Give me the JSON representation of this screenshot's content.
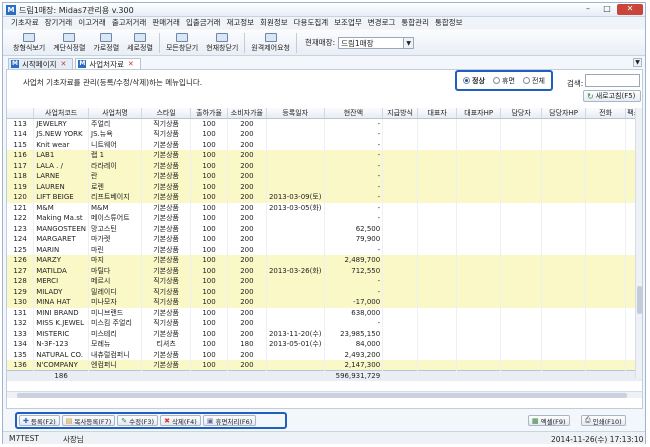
{
  "window": {
    "title": "드림1매장: Midas7관리용 v.300",
    "controls": [
      "–",
      "□",
      "✕"
    ]
  },
  "menu": [
    "기초자료",
    "장기거래",
    "이고거래",
    "출고저거래",
    "판매거래",
    "입출금거래",
    "재고정보",
    "회원정보",
    "다용도집계",
    "보조업무",
    "변경로그",
    "통합관리",
    "통합정보"
  ],
  "toolbar": {
    "buttons": [
      "창형식보기",
      "계단식정렬",
      "가로정렬",
      "세로정렬",
      "모든창닫기",
      "현재창닫기",
      "원격제어요청"
    ],
    "shop_label": "현재매장:",
    "shop_value": "드림1매장"
  },
  "tabs": [
    {
      "label": "시작페이지",
      "closable": true
    },
    {
      "label": "사업처자료",
      "closable": true
    }
  ],
  "page": {
    "description": "사업처 기초자료를 관리(등록/수정/삭제)하는 메뉴입니다.",
    "status_filter": {
      "options": [
        "정상",
        "휴면",
        "전체"
      ],
      "selected": "정상"
    },
    "search_label": "검색:",
    "search_value": "",
    "refresh_label": "새로고침(F5)"
  },
  "table": {
    "columns": [
      "",
      "사업처코드",
      "사업처명",
      "스타일",
      "출하가율",
      "소비자가율",
      "등록일자",
      "현잔액",
      "지급방식",
      "대표자",
      "대표자HP",
      "담당자",
      "담당자HP",
      "전화",
      "팩스"
    ],
    "rows": [
      {
        "no": "113",
        "code": "JEWELRY",
        "name": "주얼리",
        "style": "직기상품",
        "ship": "100",
        "cons": "200",
        "date": "",
        "balance": "-",
        "hl": false
      },
      {
        "no": "114",
        "code": "JS.NEW YORK",
        "name": "JS.뉴욕",
        "style": "직기상품",
        "ship": "100",
        "cons": "200",
        "date": "",
        "balance": "-",
        "hl": false
      },
      {
        "no": "115",
        "code": "Knit wear",
        "name": "니트웨어",
        "style": "기본상품",
        "ship": "100",
        "cons": "200",
        "date": "",
        "balance": "-",
        "hl": false
      },
      {
        "no": "116",
        "code": "LAB1",
        "name": "랩 1",
        "style": "기본상품",
        "ship": "100",
        "cons": "200",
        "date": "",
        "balance": "-",
        "hl": true
      },
      {
        "no": "117",
        "code": "LALA . /",
        "name": "라라레이",
        "style": "기본상품",
        "ship": "100",
        "cons": "200",
        "date": "",
        "balance": "-",
        "hl": true
      },
      {
        "no": "118",
        "code": "LARNE",
        "name": "란",
        "style": "기본상품",
        "ship": "100",
        "cons": "200",
        "date": "",
        "balance": "-",
        "hl": true
      },
      {
        "no": "119",
        "code": "LAUREN",
        "name": "로렌",
        "style": "기본상품",
        "ship": "100",
        "cons": "200",
        "date": "",
        "balance": "-",
        "hl": true
      },
      {
        "no": "120",
        "code": "LIFT BEIGE",
        "name": "리프트베이지",
        "style": "기본상품",
        "ship": "100",
        "cons": "200",
        "date": "2013-03-09(토)",
        "balance": "-",
        "hl": true
      },
      {
        "no": "121",
        "code": "M&M",
        "name": "M&M",
        "style": "기본상품",
        "ship": "100",
        "cons": "200",
        "date": "2013-03-05(화)",
        "balance": "-",
        "hl": false
      },
      {
        "no": "122",
        "code": "Making Ma.st",
        "name": "메이스튜어트",
        "style": "기본상품",
        "ship": "100",
        "cons": "200",
        "date": "",
        "balance": "-",
        "hl": false
      },
      {
        "no": "123",
        "code": "MANGOSTEEN",
        "name": "망고스틴",
        "style": "기본상품",
        "ship": "100",
        "cons": "200",
        "date": "",
        "balance": "62,500",
        "hl": false
      },
      {
        "no": "124",
        "code": "MARGARET",
        "name": "마가렛",
        "style": "기본상품",
        "ship": "100",
        "cons": "200",
        "date": "",
        "balance": "79,900",
        "hl": false
      },
      {
        "no": "125",
        "code": "MARIN",
        "name": "마린",
        "style": "기본상품",
        "ship": "100",
        "cons": "200",
        "date": "",
        "balance": "-",
        "hl": false
      },
      {
        "no": "126",
        "code": "MARZY",
        "name": "마지",
        "style": "기본상품",
        "ship": "100",
        "cons": "200",
        "date": "",
        "balance": "2,489,700",
        "hl": true
      },
      {
        "no": "127",
        "code": "MATILDA",
        "name": "마틸다",
        "style": "기본상품",
        "ship": "100",
        "cons": "200",
        "date": "2013-03-26(화)",
        "balance": "712,550",
        "hl": true
      },
      {
        "no": "128",
        "code": "MERCI",
        "name": "메르시",
        "style": "직기상품",
        "ship": "100",
        "cons": "200",
        "date": "",
        "balance": "-",
        "hl": true
      },
      {
        "no": "129",
        "code": "MILADY",
        "name": "밀레이디",
        "style": "직기상품",
        "ship": "100",
        "cons": "200",
        "date": "",
        "balance": "-",
        "hl": true
      },
      {
        "no": "130",
        "code": "MINA HAT",
        "name": "미나모자",
        "style": "직기상품",
        "ship": "100",
        "cons": "200",
        "date": "",
        "balance": "-17,000",
        "hl": true
      },
      {
        "no": "131",
        "code": "MINI BRAND",
        "name": "미니브랜드",
        "style": "기본상품",
        "ship": "100",
        "cons": "200",
        "date": "",
        "balance": "638,000",
        "hl": false
      },
      {
        "no": "132",
        "code": "MISS K.JEWEL",
        "name": "미스킴 주얼리",
        "style": "직기상품",
        "ship": "100",
        "cons": "200",
        "date": "",
        "balance": "-",
        "hl": false
      },
      {
        "no": "133",
        "code": "MISTERIC",
        "name": "미스테리",
        "style": "기본상품",
        "ship": "100",
        "cons": "200",
        "date": "2013-11-20(수)",
        "balance": "23,985,150",
        "hl": false
      },
      {
        "no": "134",
        "code": "N-3F-123",
        "name": "모례뉴",
        "style": "티셔츠",
        "ship": "100",
        "cons": "180",
        "date": "2013-05-01(수)",
        "balance": "84,000",
        "hl": false
      },
      {
        "no": "135",
        "code": "NATURAL CO.",
        "name": "내츄럴컴퍼니",
        "style": "기본상품",
        "ship": "100",
        "cons": "200",
        "date": "",
        "balance": "2,493,200",
        "hl": false
      },
      {
        "no": "136",
        "code": "N'COMPANY",
        "name": "엔컴퍼니",
        "style": "기본상품",
        "ship": "100",
        "cons": "200",
        "date": "",
        "balance": "2,147,300",
        "hl": true
      }
    ],
    "footer": {
      "count": "186",
      "total_balance": "596,931,729"
    }
  },
  "actions": [
    {
      "label": "등록(F2)",
      "icon": "plus-icon",
      "glyph": "✚",
      "color": "#2b6cc4"
    },
    {
      "label": "복사등록(F7)",
      "icon": "copy-icon",
      "glyph": "▤",
      "color": "#c98a1a"
    },
    {
      "label": "수정(F3)",
      "icon": "pencil-icon",
      "glyph": "✎",
      "color": "#3c8c3c"
    },
    {
      "label": "삭제(F4)",
      "icon": "delete-x-icon",
      "glyph": "✖",
      "color": "#d03a2f"
    },
    {
      "label": "휴면처리(F6)",
      "icon": "archive-icon",
      "glyph": "▣",
      "color": "#6a6a9a"
    }
  ],
  "right_actions": {
    "excel": {
      "label": "엑셀(F9)",
      "glyph": "▦"
    },
    "print": {
      "label": "인쇄(F10)",
      "glyph": "⎙"
    }
  },
  "status": {
    "company": "M7TEST",
    "user": "사장님",
    "datetime": "2014-11-26(수) 17:13:10"
  }
}
